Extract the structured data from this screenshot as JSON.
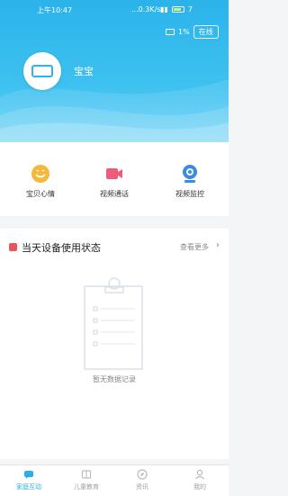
{
  "status_bar": {
    "time": "上午10:47",
    "network_speed": "...0.3K/s",
    "battery_label": "7"
  },
  "header": {
    "device_battery": "1%",
    "online_status": "在线",
    "baby_name": "宝宝"
  },
  "quick_actions": [
    {
      "label": "宝贝心情",
      "icon": "smile-icon"
    },
    {
      "label": "视频通话",
      "icon": "video-camera-icon"
    },
    {
      "label": "视频监控",
      "icon": "webcam-icon"
    }
  ],
  "usage_section": {
    "title": "当天设备使用状态",
    "more": "查看更多",
    "empty_text": "暂无数据记录"
  },
  "tabs": [
    {
      "label": "家庭互动",
      "icon": "chat-icon",
      "active": true
    },
    {
      "label": "儿童教育",
      "icon": "book-icon",
      "active": false
    },
    {
      "label": "资讯",
      "icon": "compass-icon",
      "active": false
    },
    {
      "label": "我的",
      "icon": "user-icon",
      "active": false
    }
  ],
  "colors": {
    "brand": "#2bb3ea",
    "accent_red": "#e9545a",
    "smile_yellow": "#f5b83a",
    "video_pink": "#f15b7a",
    "webcam_blue": "#3a8be5"
  }
}
